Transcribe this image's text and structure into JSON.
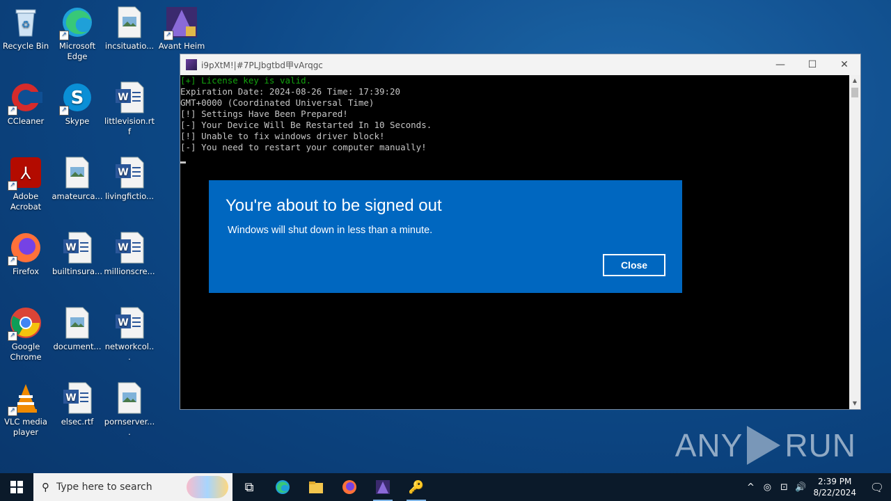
{
  "desktop": {
    "icons": [
      {
        "label": "Recycle Bin",
        "icon": "recycle-bin-icon"
      },
      {
        "label": "Microsoft Edge",
        "icon": "edge-icon"
      },
      {
        "label": "incsituatio...",
        "icon": "image-file-icon"
      },
      {
        "label": "Avant Heim",
        "icon": "app-icon"
      },
      {
        "label": "CCleaner",
        "icon": "ccleaner-icon"
      },
      {
        "label": "Skype",
        "icon": "skype-icon"
      },
      {
        "label": "littlevision.rtf",
        "icon": "word-doc-icon"
      },
      {
        "label": "Adobe Acrobat",
        "icon": "acrobat-icon"
      },
      {
        "label": "amateurca...",
        "icon": "image-file-icon"
      },
      {
        "label": "livingfictio...",
        "icon": "word-doc-icon"
      },
      {
        "label": "Firefox",
        "icon": "firefox-icon"
      },
      {
        "label": "builtinsura...",
        "icon": "word-doc-icon"
      },
      {
        "label": "millionscre...",
        "icon": "word-doc-icon"
      },
      {
        "label": "Google Chrome",
        "icon": "chrome-icon"
      },
      {
        "label": "document...",
        "icon": "image-file-icon"
      },
      {
        "label": "networkcol...",
        "icon": "word-doc-icon"
      },
      {
        "label": "VLC media player",
        "icon": "vlc-icon"
      },
      {
        "label": "elsec.rtf",
        "icon": "word-doc-icon"
      },
      {
        "label": "pornserver....",
        "icon": "image-file-icon"
      }
    ]
  },
  "console": {
    "title": "i9pXtM!|#7PLJbgtbd甲vArqgc",
    "lines": [
      "[+] License key is valid.",
      "Expiration Date: 2024-08-26 Time: 17:39:20",
      "GMT+0000 (Coordinated Universal Time)",
      "[!] Settings Have Been Prepared!",
      "[-] Your Device Will Be Restarted In 10 Seconds.",
      "[!] Unable to fix windows driver block!",
      "[-] You need to restart your computer manually!"
    ],
    "minimize": "—",
    "maximize": "☐",
    "close": "✕"
  },
  "dialog": {
    "title": "You're about to be signed out",
    "message": "Windows will shut down in less than a minute.",
    "close_label": "Close"
  },
  "watermark": {
    "left": "ANY",
    "right": "RUN"
  },
  "taskbar": {
    "search_placeholder": "Type here to search",
    "time": "2:39 PM",
    "date": "8/22/2024"
  }
}
